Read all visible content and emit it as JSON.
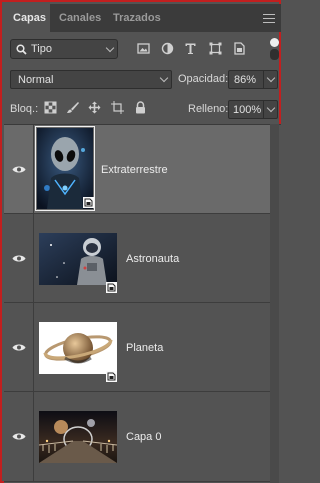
{
  "tabs": [
    {
      "label": "Capas",
      "active": true
    },
    {
      "label": "Canales",
      "active": false
    },
    {
      "label": "Trazados",
      "active": false
    }
  ],
  "filter": {
    "kind_label": "Tipo",
    "icons": [
      "pixel-filter-icon",
      "adjustment-filter-icon",
      "type-filter-icon",
      "shape-filter-icon",
      "smart-object-filter-icon"
    ]
  },
  "blend": {
    "mode": "Normal",
    "opacity_label": "Opacidad:",
    "opacity_value": "86%"
  },
  "lock": {
    "label": "Bloq.:",
    "icons": [
      "lock-transparent-pixels-icon",
      "lock-image-pixels-icon",
      "lock-position-icon",
      "lock-artboard-icon",
      "lock-all-icon"
    ],
    "fill_label": "Relleno:",
    "fill_value": "100%"
  },
  "layers": [
    {
      "name": "Extraterrestre",
      "visible": true,
      "selected": true,
      "smart_object": true,
      "thumb": "alien"
    },
    {
      "name": "Astronauta",
      "visible": true,
      "selected": false,
      "smart_object": true,
      "thumb": "astronaut"
    },
    {
      "name": "Planeta",
      "visible": true,
      "selected": false,
      "smart_object": true,
      "thumb": "planet"
    },
    {
      "name": "Capa 0",
      "visible": true,
      "selected": false,
      "smart_object": false,
      "thumb": "bridge"
    }
  ],
  "colors": {
    "panel_bg": "#535353",
    "selected_bg": "#6a6a6a",
    "frame": "#c21f1f"
  }
}
